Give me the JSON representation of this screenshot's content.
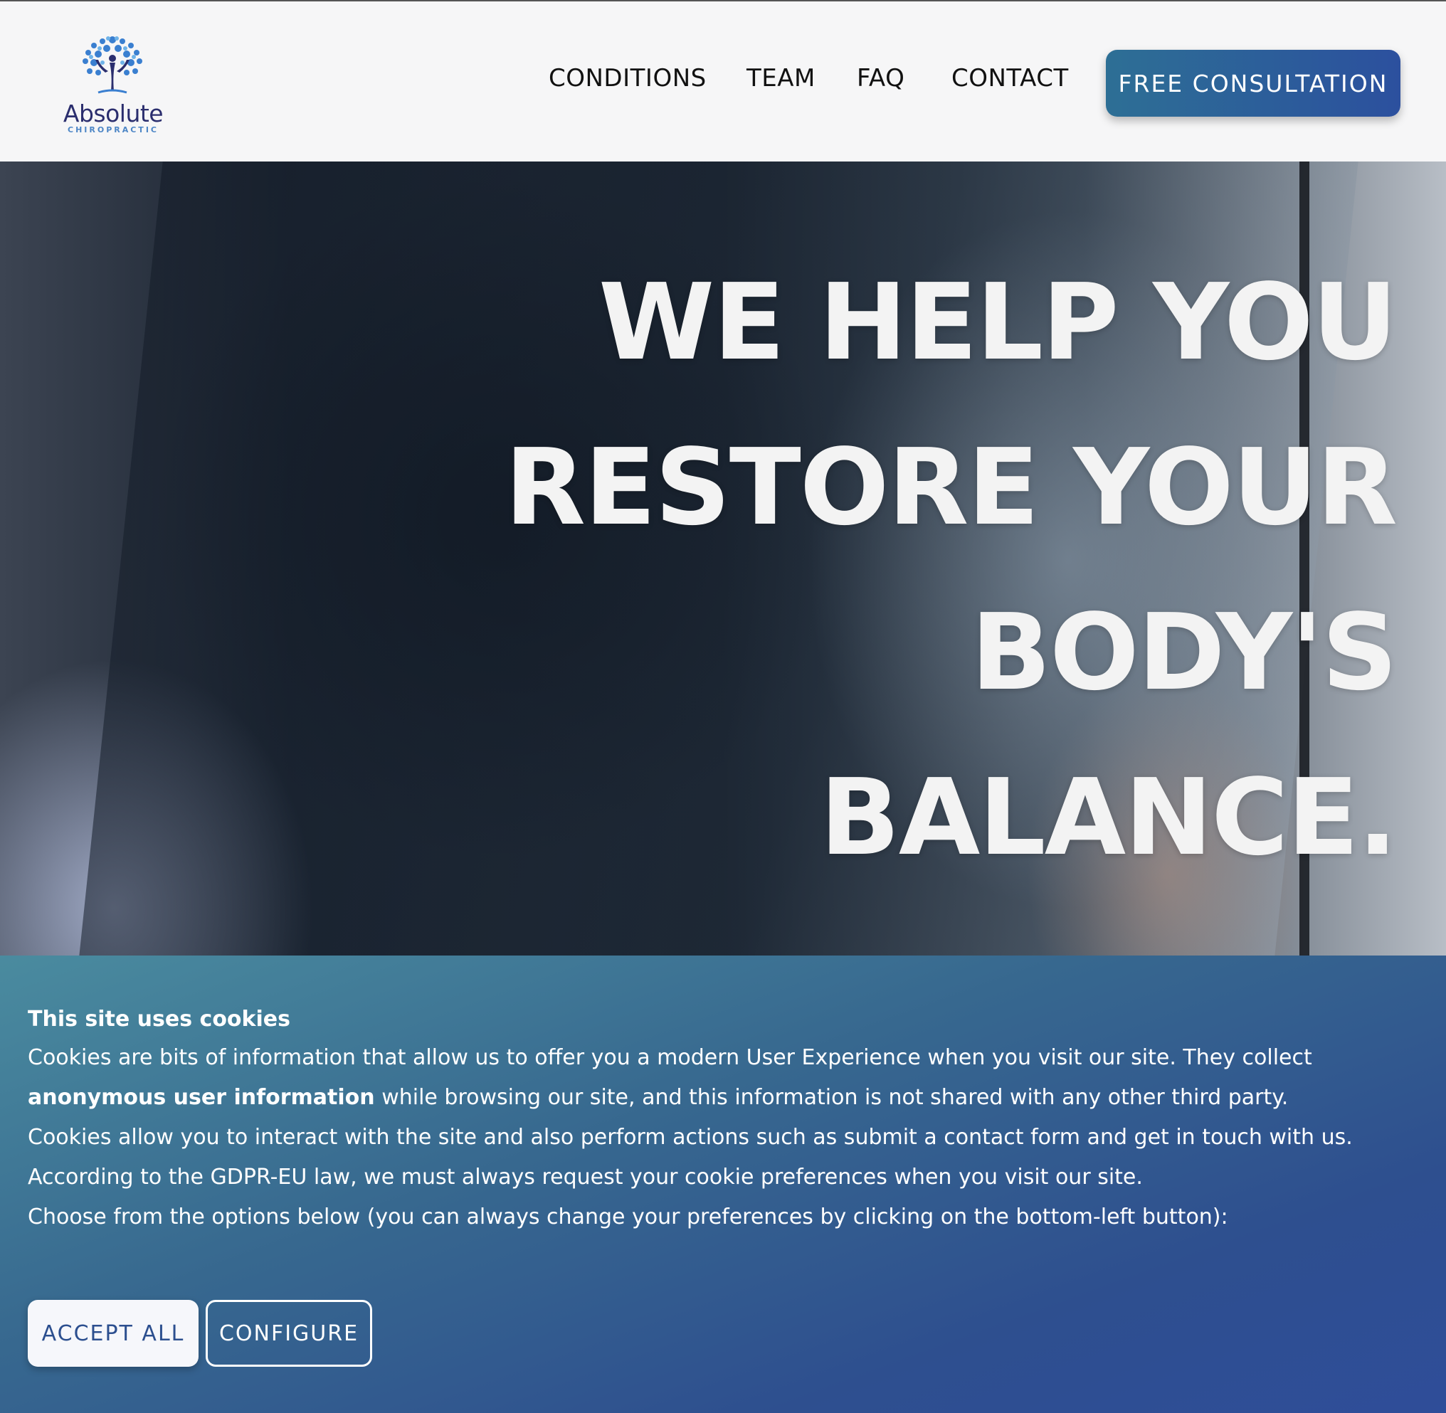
{
  "brand": {
    "name": "Absolute",
    "tagline": "CHIROPRACTIC",
    "colors": {
      "primary": "#2c509e",
      "teal": "#2d6f95",
      "logo_text": "#2b2e6e",
      "logo_accent": "#4d86c6"
    }
  },
  "nav": {
    "items": [
      {
        "label": "CONDITIONS"
      },
      {
        "label": "TEAM"
      },
      {
        "label": "FAQ"
      },
      {
        "label": "CONTACT"
      }
    ],
    "cta_label": "FREE CONSULTATION"
  },
  "hero": {
    "lines": [
      "WE HELP YOU",
      "RESTORE YOUR",
      "BODY'S",
      "BALANCE."
    ]
  },
  "cookie_banner": {
    "title": "This site uses cookies",
    "line1": "Cookies are bits of information that allow us to offer you a modern User Experience when you visit our site. They collect",
    "line2_bold": "anonymous user information",
    "line2_rest": " while browsing our site, and this information is not shared with any other third party.",
    "line3": "Cookies allow you to interact with the site and also perform actions such as submit a contact form and get in touch with us.",
    "line4": "According to the GDPR-EU law, we must always request your cookie preferences when you visit our site.",
    "line5": "Choose from the options below (you can always change your preferences by clicking on the bottom-left button):",
    "accept_label": "ACCEPT ALL",
    "configure_label": "CONFIGURE"
  }
}
